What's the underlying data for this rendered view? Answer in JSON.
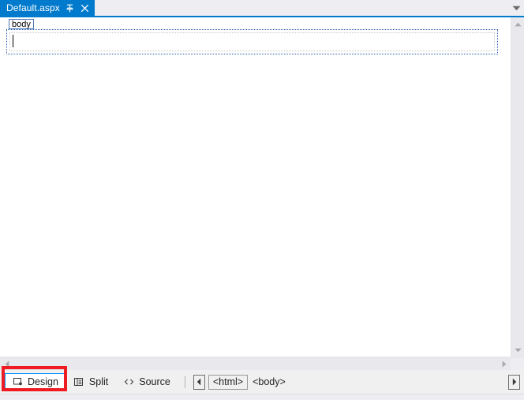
{
  "window": {
    "app": "Visual Studio Web Forms Designer"
  },
  "tabstrip": {
    "tabs": [
      {
        "title": "Default.aspx",
        "active": true,
        "pin_icon": "pin-icon",
        "close_icon": "close-icon"
      }
    ],
    "overflow_icon": "chevron-down-icon"
  },
  "designer": {
    "tag_label": "body",
    "caret_visible": true,
    "background": "#ffffff",
    "body_region_border_color": "#2a5db0",
    "form_region_border_color": "#c8c8c8"
  },
  "scrollbars": {
    "vertical": {
      "up_icon": "triangle-up-icon",
      "down_icon": "triangle-down-icon"
    },
    "horizontal": {
      "left_icon": "triangle-left-icon",
      "right_icon": "triangle-right-icon"
    }
  },
  "viewbar": {
    "buttons": [
      {
        "label": "Design",
        "icon": "design-view-icon",
        "selected": true
      },
      {
        "label": "Split",
        "icon": "split-view-icon",
        "selected": false
      },
      {
        "label": "Source",
        "icon": "source-view-icon",
        "selected": false
      }
    ],
    "breadcrumb": {
      "nav_left_icon": "triangle-left-icon",
      "nav_right_icon": "triangle-right-icon",
      "items": [
        {
          "label": "<html>",
          "boxed": true
        },
        {
          "label": "<body>",
          "boxed": false
        }
      ]
    }
  },
  "annotation": {
    "color": "#ef1b22",
    "target": "Design",
    "shape": "rectangle"
  },
  "colors": {
    "tab_active_bg": "#007acc",
    "tab_active_fg": "#ffffff",
    "chrome_bg": "#eeeef2",
    "viewbar_bg": "#f0f0f0",
    "selection_blue": "#0097fb",
    "scrollbar_bg": "#e9e9ed",
    "annotation_red": "#ef1b22"
  }
}
